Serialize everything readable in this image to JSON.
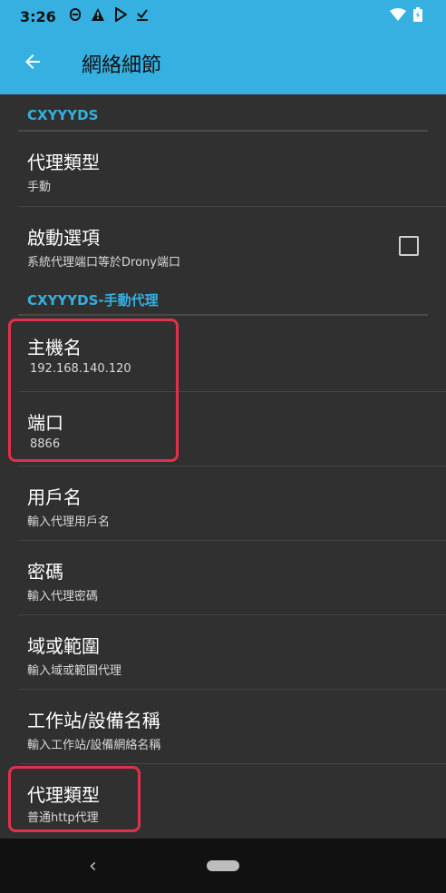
{
  "status": {
    "time": "3:26"
  },
  "app": {
    "title": "網絡細節",
    "accent": "#35b0e0"
  },
  "sections": {
    "network": "CXYYYDS",
    "proxy": "CXYYYDS-手動代理"
  },
  "items": [
    {
      "title": "代理類型",
      "summary": "手動"
    },
    {
      "title": "啟動選項",
      "summary": "系統代理端口等於Drony端口",
      "checkbox_checked": false
    },
    {
      "title": "主機名",
      "summary": "192.168.140.120"
    },
    {
      "title": "端口",
      "summary": "8866"
    },
    {
      "title": "用戶名",
      "summary": "輸入代理用戶名"
    },
    {
      "title": "密碼",
      "summary": "輸入代理密碼"
    },
    {
      "title": "域或範圍",
      "summary": "輸入域或範圍代理"
    },
    {
      "title": "工作站/設備名稱",
      "summary": "輸入工作站/設備網絡名稱"
    },
    {
      "title": "代理類型",
      "summary": "普通http代理"
    }
  ]
}
